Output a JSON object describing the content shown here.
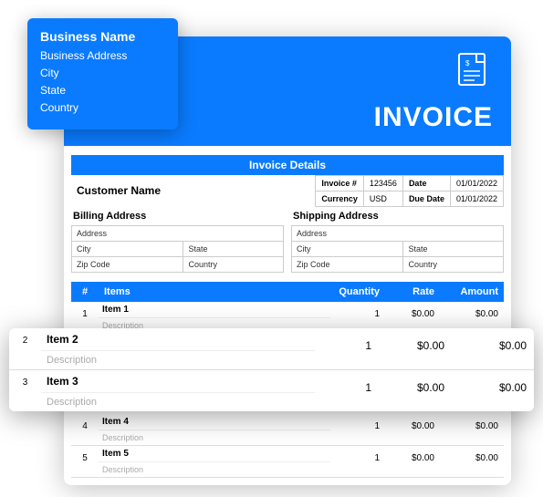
{
  "business": {
    "name": "Business Name",
    "address": "Business Address",
    "city": "City",
    "state": "State",
    "country": "Country"
  },
  "header": {
    "title": "INVOICE"
  },
  "details_bar": "Invoice Details",
  "customer_name": "Customer Name",
  "meta": {
    "invoice_num_lbl": "Invoice #",
    "invoice_num": "123456",
    "date_lbl": "Date",
    "date": "01/01/2022",
    "currency_lbl": "Currency",
    "currency": "USD",
    "due_lbl": "Due Date",
    "due": "01/01/2022"
  },
  "billing": {
    "title": "Billing Address",
    "address": "Address",
    "city": "City",
    "state": "State",
    "zip": "Zip Code",
    "country": "Country"
  },
  "shipping": {
    "title": "Shipping Address",
    "address": "Address",
    "city": "City",
    "state": "State",
    "zip": "Zip Code",
    "country": "Country"
  },
  "cols": {
    "num": "#",
    "items": "Items",
    "qty": "Quantity",
    "rate": "Rate",
    "amt": "Amount"
  },
  "items": [
    {
      "n": "1",
      "name": "Item 1",
      "desc": "Description",
      "qty": "1",
      "rate": "$0.00",
      "amt": "$0.00"
    },
    {
      "n": "2",
      "name": "Item 2",
      "desc": "Description",
      "qty": "1",
      "rate": "$0.00",
      "amt": "$0.00"
    },
    {
      "n": "3",
      "name": "Item 3",
      "desc": "Description",
      "qty": "1",
      "rate": "$0.00",
      "amt": "$0.00"
    },
    {
      "n": "4",
      "name": "Item 4",
      "desc": "Description",
      "qty": "1",
      "rate": "$0.00",
      "amt": "$0.00"
    },
    {
      "n": "5",
      "name": "Item 5",
      "desc": "Description",
      "qty": "1",
      "rate": "$0.00",
      "amt": "$0.00"
    }
  ]
}
